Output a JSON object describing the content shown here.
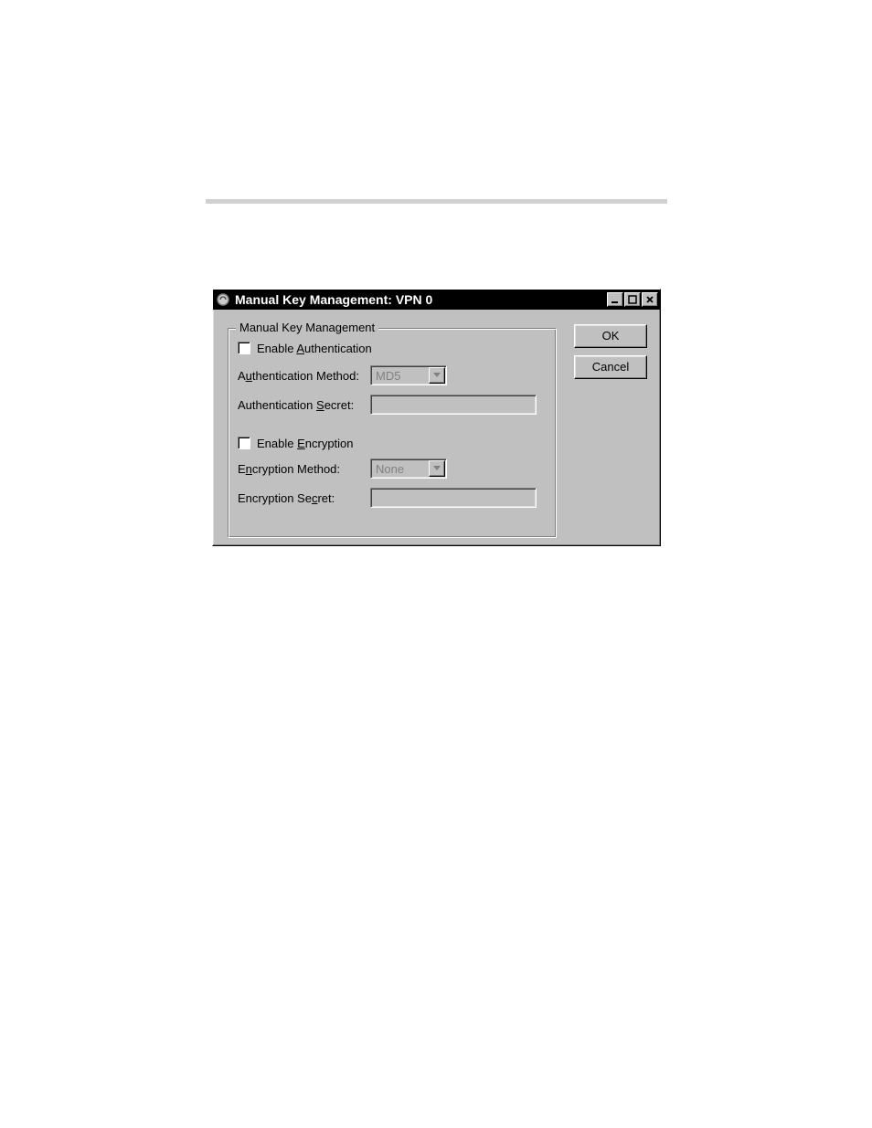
{
  "window": {
    "title": "Manual Key Management: VPN 0",
    "ok_label": "OK",
    "cancel_label": "Cancel"
  },
  "group": {
    "legend": "Manual Key Management",
    "enable_auth_label_pre": "Enable ",
    "enable_auth_underline": "A",
    "enable_auth_label_post": "uthentication",
    "auth_method_label_pre": "A",
    "auth_method_underline": "u",
    "auth_method_label_post": "thentication Method:",
    "auth_method_value": "MD5",
    "auth_secret_label_pre": "Authentication ",
    "auth_secret_underline": "S",
    "auth_secret_label_post": "ecret:",
    "auth_secret_value": "",
    "enable_enc_label_pre": "Enable ",
    "enable_enc_underline": "E",
    "enable_enc_label_post": "ncryption",
    "enc_method_label_pre": "E",
    "enc_method_underline": "n",
    "enc_method_label_post": "cryption Method:",
    "enc_method_value": "None",
    "enc_secret_label_pre": "Encryption Se",
    "enc_secret_underline": "c",
    "enc_secret_label_post": "ret:",
    "enc_secret_value": ""
  }
}
